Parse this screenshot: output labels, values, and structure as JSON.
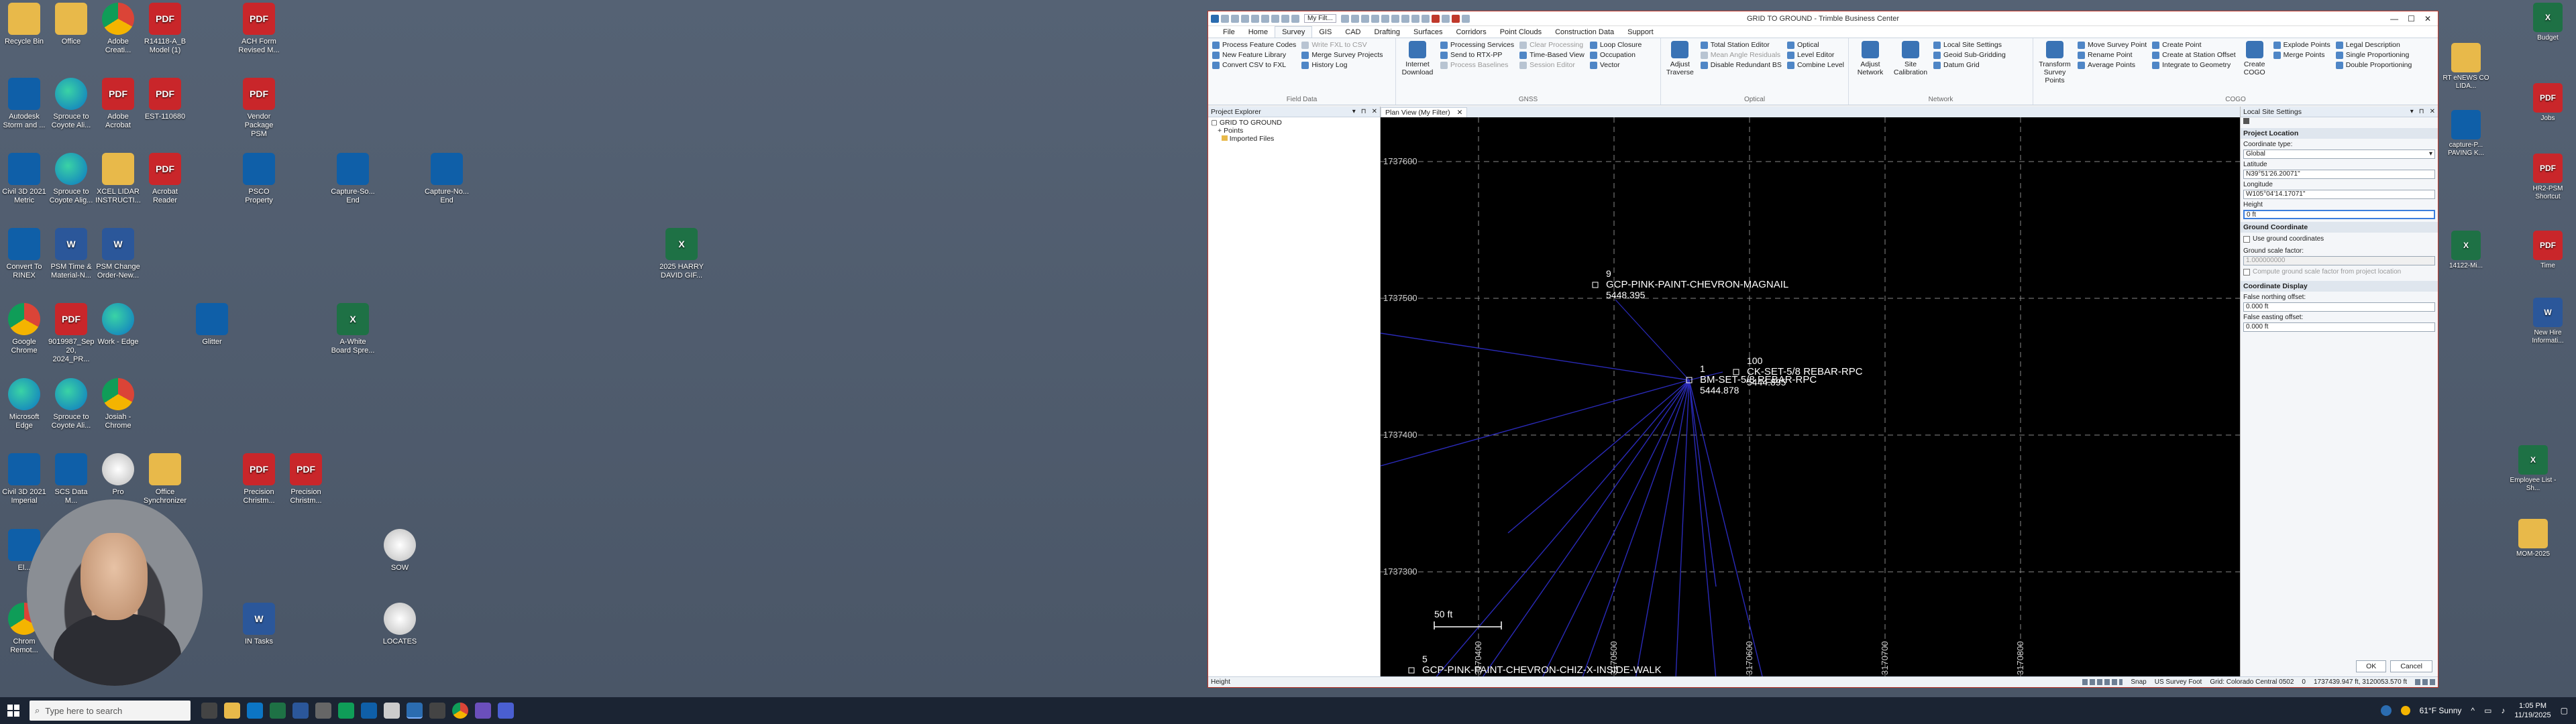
{
  "desktop": {
    "icons": [
      {
        "label": "Recycle Bin",
        "type": "folder"
      },
      {
        "label": "Office",
        "type": "folder"
      },
      {
        "label": "Adobe Creati...",
        "type": "chrome"
      },
      {
        "label": "R14118-A_B Model (1)",
        "type": "pdf"
      },
      {
        "label": "ACH Form Revised M...",
        "type": "pdf"
      },
      {
        "label": "Autodesk Storm and ...",
        "type": "civ"
      },
      {
        "label": "Sprouce to Coyote Ali...",
        "type": "edge"
      },
      {
        "label": "Adobe Acrobat",
        "type": "pdf"
      },
      {
        "label": "EST-110680",
        "type": "pdf"
      },
      {
        "label": "Vendor Package PSM",
        "type": "pdf"
      },
      {
        "label": "Civil 3D 2021 Metric",
        "type": "civ"
      },
      {
        "label": "Sprouce to Coyote Alig...",
        "type": "edge"
      },
      {
        "label": "XCEL LIDAR INSTRUCTI...",
        "type": "folder"
      },
      {
        "label": "Acrobat Reader",
        "type": "pdf"
      },
      {
        "label": "PSCO Property",
        "type": "civ"
      },
      {
        "label": "Capture-So... End",
        "type": "civ"
      },
      {
        "label": "Capture-No... End",
        "type": "civ"
      },
      {
        "label": "Convert To RINEX",
        "type": "civ"
      },
      {
        "label": "PSM Time & Material-N...",
        "type": "word"
      },
      {
        "label": "PSM Change Order-New...",
        "type": "word"
      },
      {
        "label": "2025 HARRY DAVID GIF...",
        "type": "xls"
      },
      {
        "label": "Google Chrome",
        "type": "chrome"
      },
      {
        "label": "9019987_Sep 20, 2024_PR...",
        "type": "pdf"
      },
      {
        "label": "Work - Edge",
        "type": "edge"
      },
      {
        "label": "Glitter",
        "type": "civ"
      },
      {
        "label": "A-White Board Spre...",
        "type": "xls"
      },
      {
        "label": "Microsoft Edge",
        "type": "edge"
      },
      {
        "label": "Sprouce to Coyote Ali...",
        "type": "edge"
      },
      {
        "label": "Josiah - Chrome",
        "type": "chrome"
      },
      {
        "label": "Civil 3D 2021 Imperial",
        "type": "civ"
      },
      {
        "label": "SCS Data M...",
        "type": "civ"
      },
      {
        "label": "Pro",
        "type": "pro"
      },
      {
        "label": "Office Synchronizer",
        "type": "folder"
      },
      {
        "label": "Precision Christm...",
        "type": "pdf"
      },
      {
        "label": "Precision Christm...",
        "type": "pdf"
      },
      {
        "label": "SOW",
        "type": "pro"
      },
      {
        "label": "IN Tasks",
        "type": "word"
      },
      {
        "label": "LOCATES",
        "type": "pro"
      },
      {
        "label": "Chrom Remot...",
        "type": "chrome"
      },
      {
        "label": "El...",
        "type": "civ"
      }
    ],
    "right_icons": [
      {
        "label": "Budget",
        "type": "xls"
      },
      {
        "label": "RT eNEWS CO LIDA...",
        "type": "folder"
      },
      {
        "label": "Jobs",
        "type": "pdf"
      },
      {
        "label": "capture-P... PAVING K...",
        "type": "civ"
      },
      {
        "label": "HR2-PSM Shortcut",
        "type": "pdf"
      },
      {
        "label": "Time",
        "type": "pdf"
      },
      {
        "label": "14122-Mi...",
        "type": "xls"
      },
      {
        "label": "New Hire Informati...",
        "type": "word"
      },
      {
        "label": "Employee List - Sh...",
        "type": "xls"
      },
      {
        "label": "MOM-2025",
        "type": "folder"
      }
    ]
  },
  "app": {
    "title": "GRID TO GROUND - Trimble Business Center",
    "view_filter_label": "My Filt...",
    "menu": [
      "File",
      "Home",
      "Survey",
      "GIS",
      "CAD",
      "Drafting",
      "Surfaces",
      "Corridors",
      "Point Clouds",
      "Construction Data",
      "Support"
    ],
    "active_menu": "Survey",
    "ribbon": {
      "field_data": {
        "label": "Field Data",
        "items": [
          "Process Feature Codes",
          "Write FXL to CSV",
          "New Feature Library",
          "Merge Survey Projects",
          "Convert CSV to FXL",
          "History Log"
        ]
      },
      "gnss": {
        "label": "GNSS",
        "big": "Internet Download",
        "items": [
          "Processing Services",
          "Clear Processing",
          "Send to RTX-PP",
          "Time-Based View",
          "Process Baselines",
          "Session Editor",
          "Loop Closure",
          "Occupation",
          "Vector"
        ]
      },
      "optical": {
        "label": "Optical",
        "big": "Adjust Traverse",
        "items": [
          "Total Station Editor",
          "Optical",
          "Mean Angle Residuals",
          "Level Editor",
          "Disable Redundant BS",
          "Combine Level"
        ]
      },
      "network": {
        "label": "Network",
        "big1": "Adjust Network",
        "big2": "Site Calibration",
        "items": [
          "Local Site Settings",
          "Geoid Sub-Gridding",
          "Datum Grid"
        ]
      },
      "cogo": {
        "label": "COGO",
        "big1": "Transform Survey Points",
        "big2": "Create COGO",
        "items": [
          "Move Survey Point",
          "Create Point",
          "Explode Points",
          "Legal Description",
          "Rename Point",
          "Create at Station Offset",
          "Merge Points",
          "Single Proportioning",
          "Average Points",
          "Integrate to Geometry",
          "Double Proportioning"
        ]
      }
    },
    "explorer": {
      "title": "Project Explorer",
      "root": "GRID TO GROUND",
      "children": [
        "Points",
        "Imported Files"
      ]
    },
    "plan": {
      "tab": "Plan View (My Filter)",
      "northings": [
        "1737600",
        "1737500",
        "1737400",
        "1737300"
      ],
      "eastings": [
        "3170400",
        "3170500",
        "3170600",
        "3170700",
        "3170800"
      ],
      "scale_label": "50 ft",
      "points": [
        {
          "num": "9",
          "desc": "GCP-PINK-PAINT-CHEVRON-MAGNAIL",
          "elev": "5448.395"
        },
        {
          "num": "1",
          "desc": "BM-SET-5/8 REBAR-RPC",
          "elev": "5444.878"
        },
        {
          "num": "100",
          "desc": "CK-SET-5/8 REBAR-RPC",
          "elev": "5444.895"
        },
        {
          "num": "5",
          "desc": "GCP-PINK-PAINT-CHEVRON-CHIZ-X-INSIDE-WALK",
          "elev": ""
        }
      ]
    },
    "settings": {
      "title": "Local Site Settings",
      "project_location": "Project Location",
      "coord_type_label": "Coordinate type:",
      "coord_type_value": "Global",
      "lat_label": "Latitude",
      "lat_value": "N39°51'26.20071\"",
      "lon_label": "Longitude",
      "lon_value": "W105°04'14.17071\"",
      "height_label": "Height",
      "height_value": "0 ft",
      "ground_coord": "Ground Coordinate",
      "use_ground": "Use ground coordinates",
      "scale_label": "Ground scale factor:",
      "scale_value": "1.000000000",
      "compute_scale": "Compute ground scale factor from project location",
      "coord_display": "Coordinate Display",
      "false_n_label": "False northing offset:",
      "false_n_value": "0.000 ft",
      "false_e_label": "False easting offset:",
      "false_e_value": "0.000 ft",
      "ok": "OK",
      "cancel": "Cancel"
    },
    "status": {
      "left": "Height",
      "snap": "Snap",
      "units": "US Survey Foot",
      "grid": "Grid: Colorado Central 0502",
      "zero": "0",
      "coords": "1737439.947 ft, 3120053.570 ft"
    }
  },
  "taskbar": {
    "search_placeholder": "Type here to search",
    "weather": "61°F  Sunny",
    "time": "1:05 PM",
    "date": "11/19/2025"
  }
}
